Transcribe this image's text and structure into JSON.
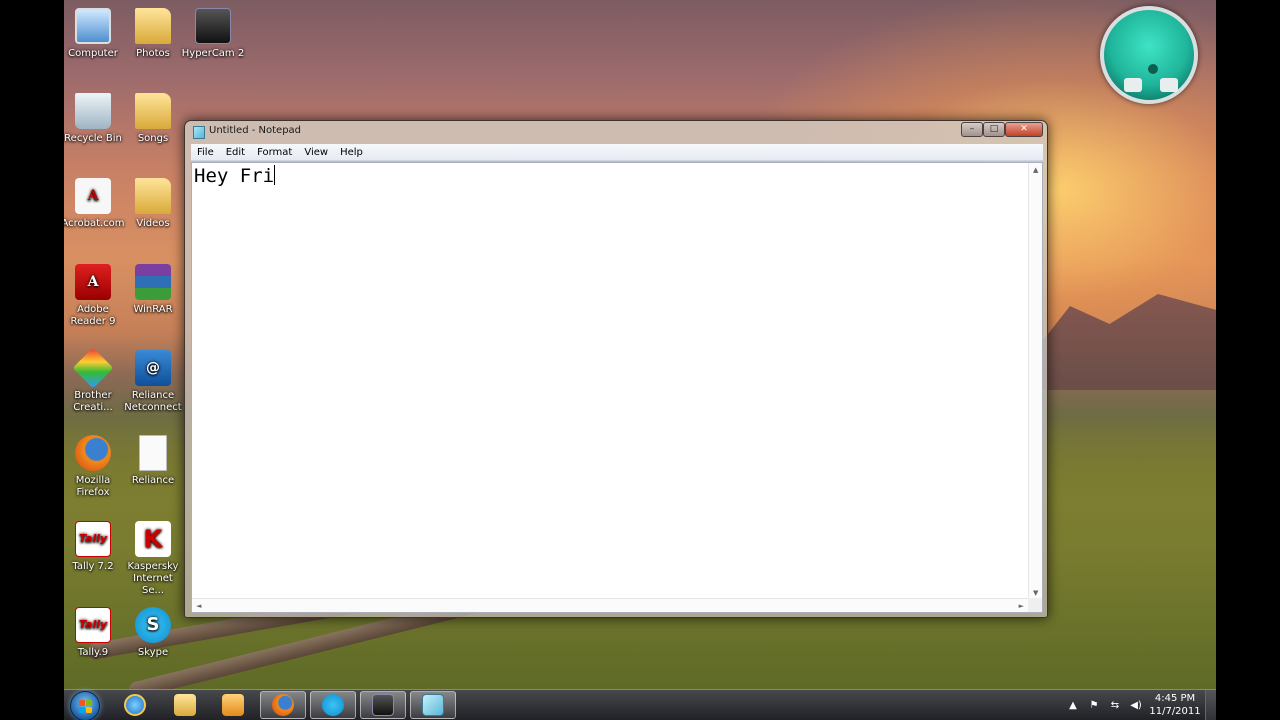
{
  "desktop": {
    "icons": [
      {
        "label": "Computer",
        "icon": "computer-icon"
      },
      {
        "label": "Photos",
        "icon": "folder-icon"
      },
      {
        "label": "HyperCam 2",
        "icon": "hypercam-icon"
      },
      {
        "label": "Recycle Bin",
        "icon": "recycle-bin-icon"
      },
      {
        "label": "Songs",
        "icon": "folder-icon"
      },
      {
        "label": "Acrobat.com",
        "icon": "acrobat-icon"
      },
      {
        "label": "Videos",
        "icon": "folder-icon"
      },
      {
        "label": "Adobe Reader 9",
        "icon": "adobe-reader-icon"
      },
      {
        "label": "WinRAR",
        "icon": "winrar-icon"
      },
      {
        "label": "Brother Creati...",
        "icon": "brother-icon"
      },
      {
        "label": "Reliance Netconnect",
        "icon": "reliance-netconnect-icon"
      },
      {
        "label": "Mozilla Firefox",
        "icon": "firefox-icon"
      },
      {
        "label": "Reliance",
        "icon": "text-file-icon"
      },
      {
        "label": "Tally 7.2",
        "icon": "tally-icon"
      },
      {
        "label": "Kaspersky Internet Se...",
        "icon": "kaspersky-icon"
      },
      {
        "label": "Tally.9",
        "icon": "tally-icon"
      },
      {
        "label": "Skype",
        "icon": "skype-icon"
      }
    ],
    "tally_glyph": "Tally",
    "kaspersky_glyph": "K",
    "adobe_glyph": "A",
    "reliance_glyph": "@",
    "skype_glyph": "S"
  },
  "notepad": {
    "title": "Untitled - Notepad",
    "menu": [
      "File",
      "Edit",
      "Format",
      "View",
      "Help"
    ],
    "content": "Hey Fri",
    "minimize_glyph": "–",
    "maximize_glyph": "□",
    "close_glyph": "✕",
    "scroll_up": "▲",
    "scroll_down": "▼",
    "scroll_left": "◄",
    "scroll_right": "►"
  },
  "taskbar": {
    "pinned": [
      "internet-explorer-icon",
      "explorer-folder-icon",
      "media-player-icon",
      "firefox-icon",
      "skype-icon",
      "hypercam-icon",
      "notepad-icon"
    ],
    "active": "notepad-icon",
    "tray": {
      "expand": "▲",
      "flag": "⚑",
      "network": "⇆",
      "volume": "◀)"
    },
    "clock": {
      "time": "4:45 PM",
      "date": "11/7/2011"
    }
  }
}
